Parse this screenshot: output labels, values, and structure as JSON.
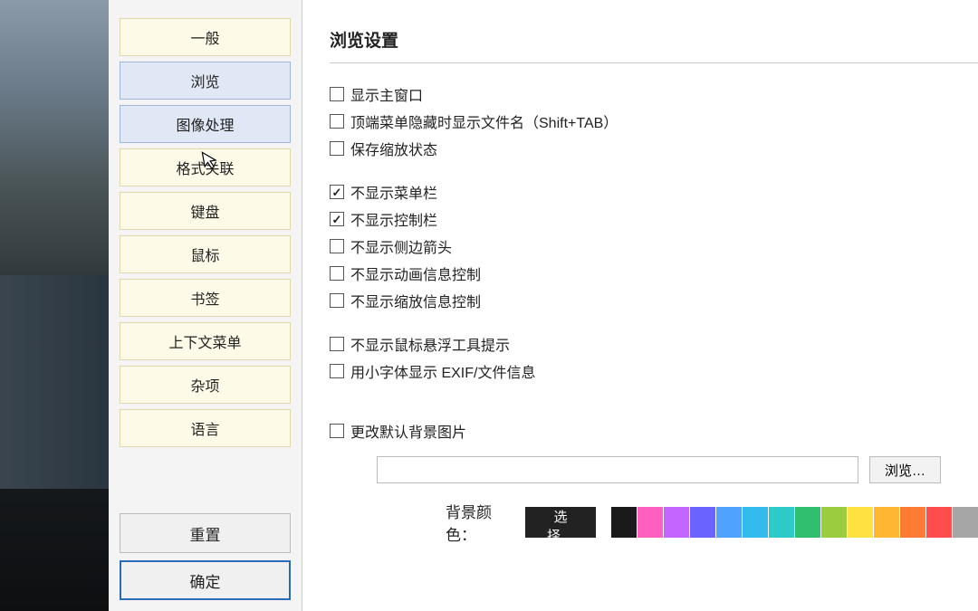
{
  "sidebar": {
    "items": [
      {
        "label": "一般"
      },
      {
        "label": "浏览"
      },
      {
        "label": "图像处理"
      },
      {
        "label": "格式关联"
      },
      {
        "label": "键盘"
      },
      {
        "label": "鼠标"
      },
      {
        "label": "书签"
      },
      {
        "label": "上下文菜单"
      },
      {
        "label": "杂项"
      },
      {
        "label": "语言"
      }
    ],
    "reset_label": "重置",
    "ok_label": "确定"
  },
  "main": {
    "title": "浏览设置",
    "checks": {
      "show_main_window": {
        "label": "显示主窗口",
        "checked": false
      },
      "show_filename_when_menu_hidden": {
        "label": "顶端菜单隐藏时显示文件名（Shift+TAB）",
        "checked": false
      },
      "save_zoom_state": {
        "label": "保存缩放状态",
        "checked": false
      },
      "hide_menubar": {
        "label": "不显示菜单栏",
        "checked": true
      },
      "hide_controlbar": {
        "label": "不显示控制栏",
        "checked": true
      },
      "hide_side_arrows": {
        "label": "不显示侧边箭头",
        "checked": false
      },
      "hide_anim_info_ctrl": {
        "label": "不显示动画信息控制",
        "checked": false
      },
      "hide_zoom_info_ctrl": {
        "label": "不显示缩放信息控制",
        "checked": false
      },
      "hide_hover_tooltip": {
        "label": "不显示鼠标悬浮工具提示",
        "checked": false
      },
      "small_font_exif": {
        "label": "用小字体显示 EXIF/文件信息",
        "checked": false
      },
      "change_default_bg": {
        "label": "更改默认背景图片",
        "checked": false
      }
    },
    "browse_label": "浏览…",
    "bg_color_label": "背景颜色：",
    "choose_label": "选择…",
    "swatches": [
      "#1a1a1a",
      "#ff5fbf",
      "#c266ff",
      "#6b63ff",
      "#4fa3ff",
      "#33bbee",
      "#2ec9c9",
      "#2fbf6e",
      "#9acc3f",
      "#ffe23f",
      "#ffb733",
      "#ff7a33",
      "#ff4d4d",
      "#a6a6a6"
    ]
  }
}
